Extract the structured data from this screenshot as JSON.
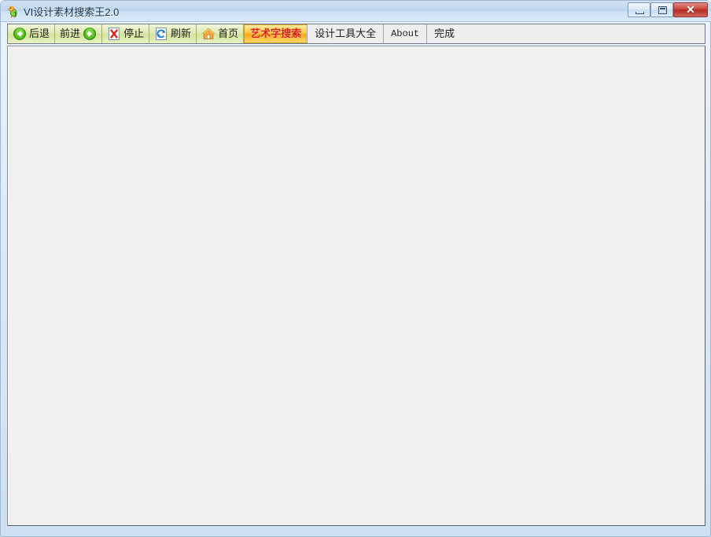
{
  "window": {
    "title": "VI设计素材搜索王2.0",
    "app_icon": "parrot-icon",
    "controls": {
      "minimize_label": "",
      "maximize_label": "",
      "close_label": "✕"
    },
    "colors": {
      "titlebar_top": "#cfe0f2",
      "titlebar_bottom": "#d8e8f8",
      "frame_border": "#9fb8d4",
      "close_button": "#c9453c",
      "toolbar_green_top": "#f2f7dc",
      "toolbar_green_bottom": "#e9f2c4",
      "gold_button_bg": "#f7a81c",
      "gold_button_text": "#d8231a",
      "content_bg": "#f0f0f0"
    }
  },
  "toolbar": {
    "buttons": [
      {
        "id": "back",
        "label": "后退",
        "icon": "arrow-left-green-icon",
        "icon_position": "left"
      },
      {
        "id": "forward",
        "label": "前进",
        "icon": "arrow-right-green-icon",
        "icon_position": "right"
      },
      {
        "id": "stop",
        "label": "停止",
        "icon": "stop-red-x-icon",
        "icon_position": "left"
      },
      {
        "id": "refresh",
        "label": "刷新",
        "icon": "refresh-blue-arrows-icon",
        "icon_position": "left"
      },
      {
        "id": "home",
        "label": "首页",
        "icon": "home-house-icon",
        "icon_position": "left"
      }
    ],
    "gold_button": {
      "id": "art-word-search",
      "label": "艺术字搜索"
    },
    "plain_buttons": [
      {
        "id": "design-tools",
        "label": "设计工具大全"
      },
      {
        "id": "about",
        "label": "About"
      }
    ],
    "status": {
      "label": "完成"
    }
  },
  "content": {
    "body_text": ""
  }
}
